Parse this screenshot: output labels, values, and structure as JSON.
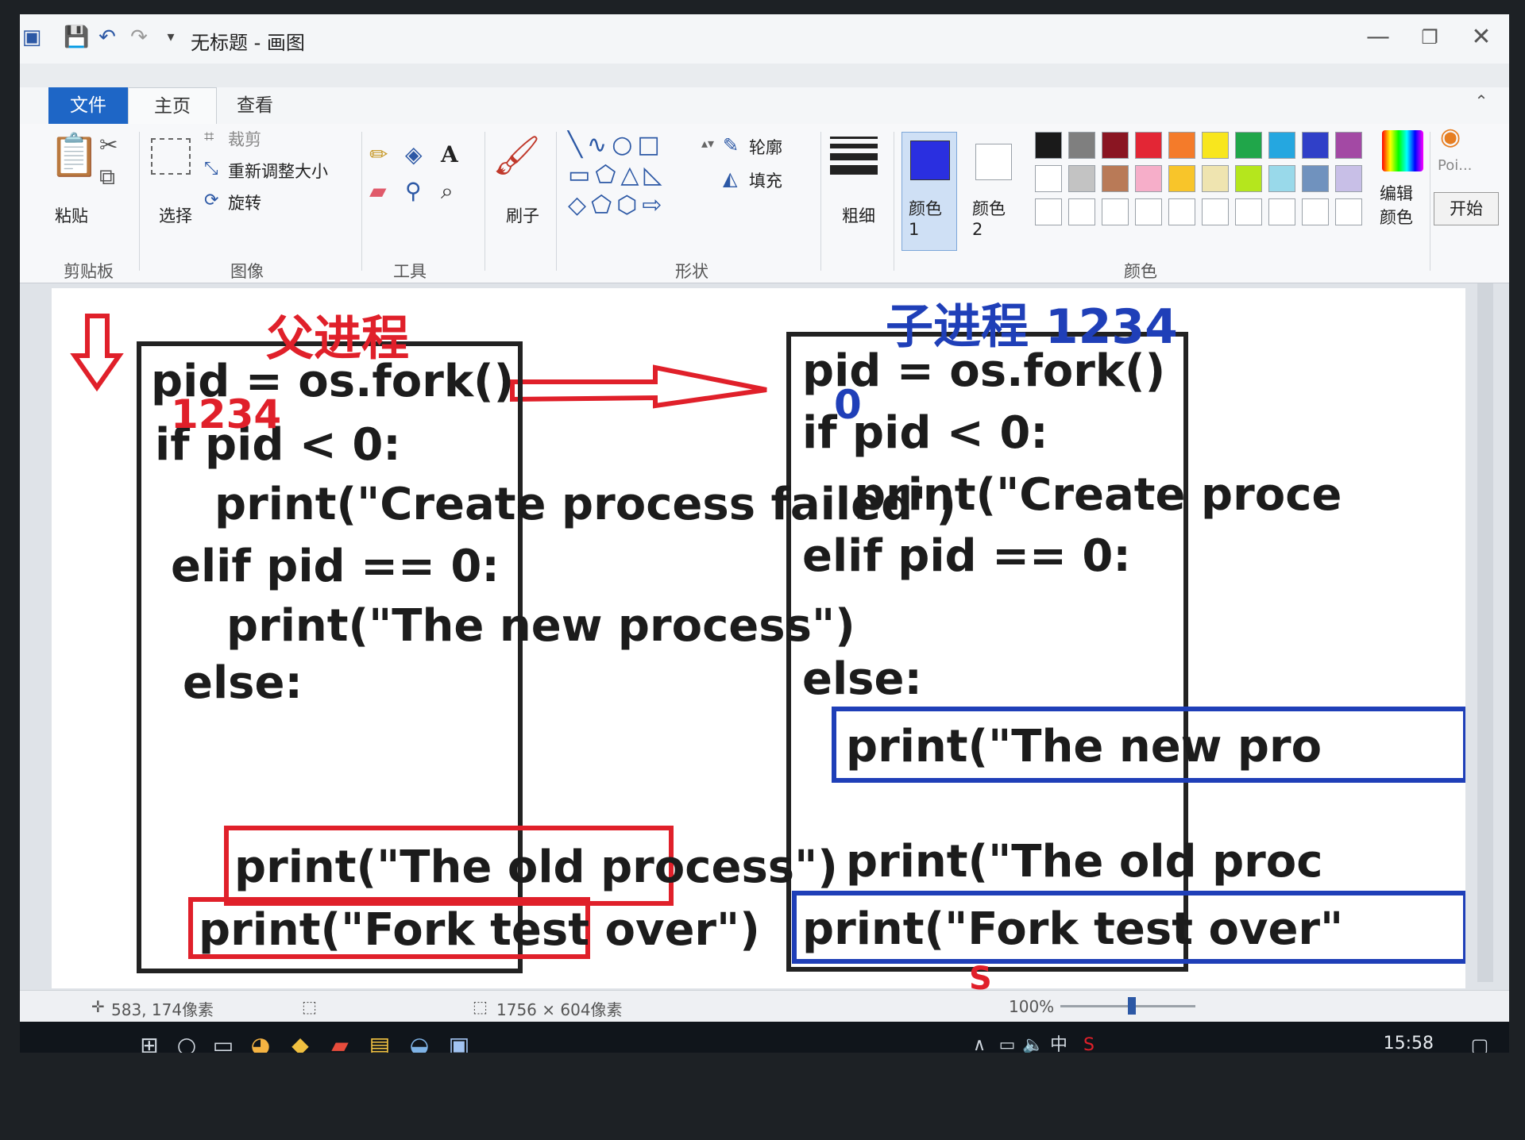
{
  "window": {
    "title": "无标题 - 画图",
    "controls": [
      "minimize-icon",
      "restore-icon",
      "close-icon"
    ]
  },
  "quick_access": [
    "save-icon",
    "undo-icon",
    "redo-icon",
    "customize-icon"
  ],
  "menu_tabs": {
    "file": "文件",
    "home": "主页",
    "view": "查看"
  },
  "ribbon": {
    "clipboard": {
      "paste": "粘贴",
      "group": "剪贴板"
    },
    "image": {
      "select": "选择",
      "crop": "裁剪",
      "resize": "重新调整大小",
      "rotate": "旋转",
      "group": "图像"
    },
    "tools": {
      "group": "工具"
    },
    "brushes": {
      "label": "刷子"
    },
    "shapes": {
      "outline": "轮廓",
      "fill": "填充",
      "group": "形状"
    },
    "size": {
      "label": "粗细"
    },
    "colors": {
      "color1_label": "颜色 1",
      "color2_label": "颜色 2",
      "edit_colors": "编辑颜色",
      "group": "颜色",
      "color1": "#2a2fe0",
      "color2": "#ffffff",
      "palette_row1": [
        "#1a1a1a",
        "#7f7f7f",
        "#8a1522",
        "#e32635",
        "#f47b2a",
        "#f8e61e",
        "#20a64a",
        "#25a7e0",
        "#3040c8",
        "#a349a4"
      ],
      "palette_row2": [
        "#ffffff",
        "#c3c3c3",
        "#b97a57",
        "#f6aec9",
        "#f8c52a",
        "#efe4b0",
        "#b5e61d",
        "#99d9ea",
        "#7092be",
        "#c8bfe7"
      ]
    },
    "paint3d": {
      "label": "Poi...",
      "open": "开始"
    }
  },
  "canvas": {
    "left_title": "父进程",
    "right_title": "子进程 1234",
    "left_code": {
      "line1": "pid = os.fork()",
      "line2": "if pid < 0:",
      "line3": "print(\"Create process failed\")",
      "line4": "elif pid == 0:",
      "line5": "print(\"The new process\")",
      "line6": "else:",
      "line7": "print(\"The old process\")",
      "line8": "print(\"Fork test over\")",
      "annotation": "1234"
    },
    "right_code": {
      "line1": "pid = os.fork()",
      "line2": "if pid < 0:",
      "line3": "print(\"Create proce",
      "line4": "elif pid == 0:",
      "line5": "print(\"The new pro",
      "line6": "else:",
      "line7": "print(\"The old proc",
      "line8": "print(\"Fork test over\"",
      "annotation": "0"
    },
    "colors": {
      "red": "#e0202a",
      "blue": "#1f3fb8",
      "black": "#222222"
    }
  },
  "status": {
    "cursor_pos": "583, 174像素",
    "image_size": "1756 × 604像素",
    "zoom": "100%"
  },
  "taskbar": {
    "time": "15:58",
    "ime": "中",
    "tray_ime": "中"
  }
}
